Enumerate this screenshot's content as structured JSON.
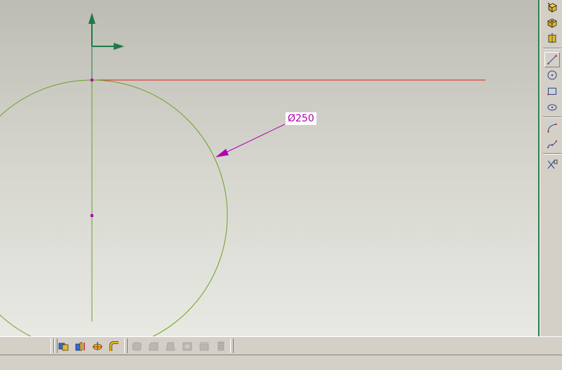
{
  "drawing": {
    "dimension_text": "Ø250"
  },
  "colors": {
    "axis": "#1e7a4a",
    "geometry": "#6aa21e",
    "reference_line": "#e0201a",
    "dimension": "#b000b0",
    "point": "#b000b0"
  },
  "right_toolbar": {
    "items": [
      {
        "icon": "pad-icon"
      },
      {
        "icon": "pocket-icon"
      },
      {
        "icon": "shaft-icon"
      },
      {
        "icon": "line-icon"
      },
      {
        "icon": "circle-icon"
      },
      {
        "icon": "rectangle-icon"
      },
      {
        "icon": "ellipse-icon"
      },
      {
        "icon": "arc-icon"
      },
      {
        "icon": "spline-icon"
      },
      {
        "icon": "constraint-icon"
      }
    ]
  },
  "bottom_toolbar": {
    "items": [
      {
        "icon": "measure-icon",
        "enabled": true
      },
      {
        "icon": "analysis-icon",
        "enabled": true
      },
      {
        "icon": "constraint-display-icon",
        "enabled": true
      },
      {
        "icon": "sweep-icon",
        "enabled": true
      },
      {
        "icon": "fillet-icon",
        "enabled": false
      },
      {
        "icon": "chamfer-icon",
        "enabled": false
      },
      {
        "icon": "draft-icon",
        "enabled": false
      },
      {
        "icon": "shell-icon",
        "enabled": false
      },
      {
        "icon": "thickness-icon",
        "enabled": false
      },
      {
        "icon": "thread-icon",
        "enabled": false
      }
    ]
  }
}
